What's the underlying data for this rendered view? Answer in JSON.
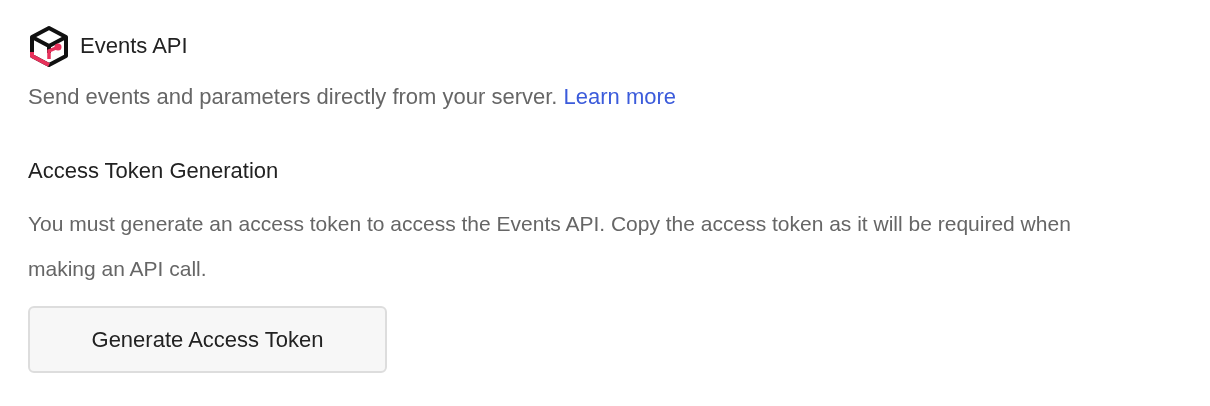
{
  "header": {
    "title": "Events API"
  },
  "description": {
    "text": "Send events and parameters directly from your server.",
    "link": "Learn more"
  },
  "section": {
    "heading": "Access Token Generation",
    "body": "You must generate an access token to access the Events API. Copy the access token as it will be required when making an API call."
  },
  "buttons": [
    "Generate Access Token"
  ]
}
